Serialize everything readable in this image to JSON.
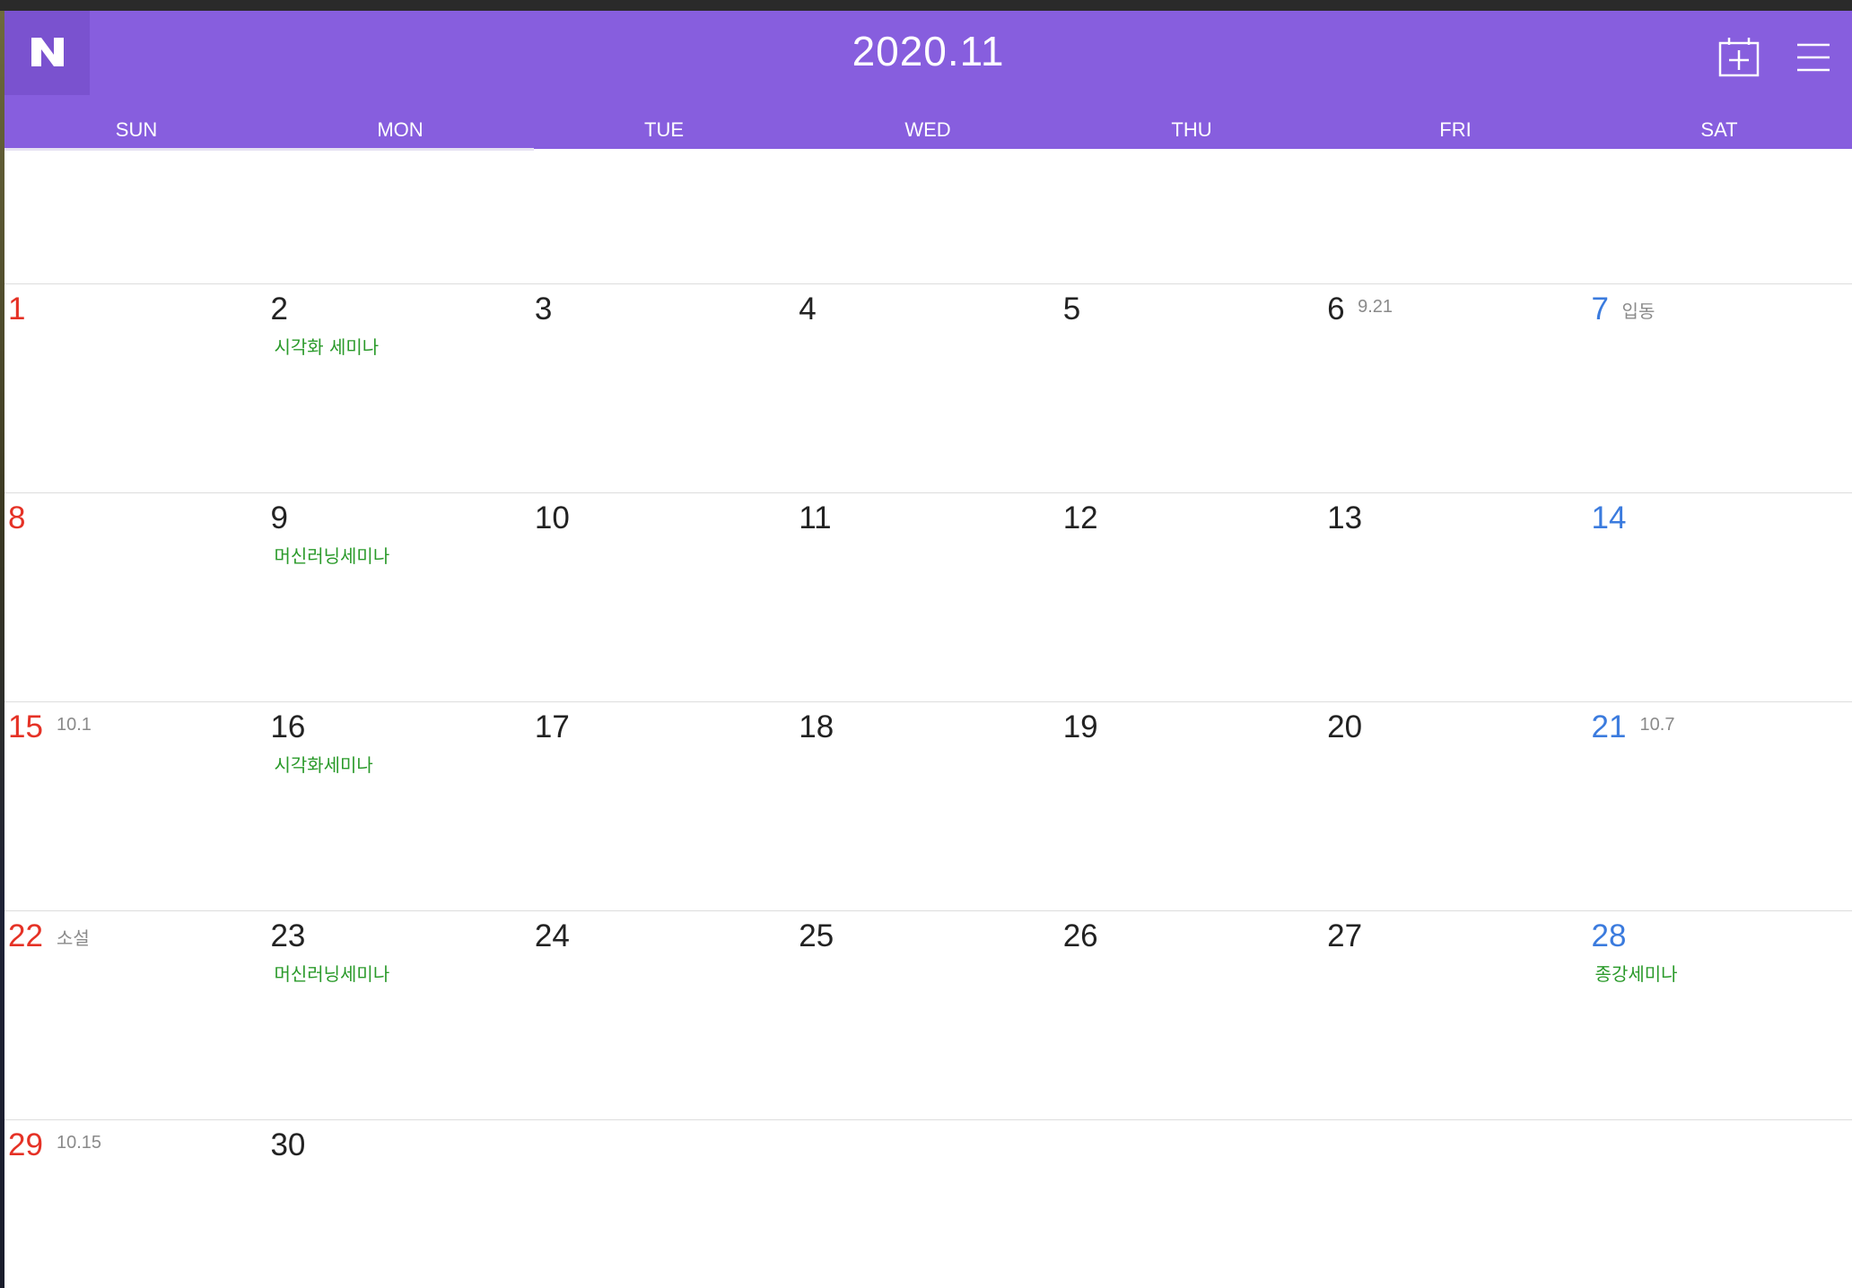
{
  "app": {
    "logo_letter": "N",
    "title": "2020.11"
  },
  "toolbar": {
    "add_icon": "calendar-add-icon",
    "menu_icon": "hamburger-menu-icon"
  },
  "colors": {
    "header": "#875ede",
    "sunday": "#e53125",
    "saturday": "#3b7bde",
    "event": "#2a9a2a",
    "lunar": "#8a8a8a"
  },
  "weekdays": [
    "SUN",
    "MON",
    "TUE",
    "WED",
    "THU",
    "FRI",
    "SAT"
  ],
  "weeks": [
    [
      {
        "day": "",
        "sub": "",
        "event": ""
      },
      {
        "day": "",
        "sub": "",
        "event": ""
      },
      {
        "day": "",
        "sub": "",
        "event": ""
      },
      {
        "day": "",
        "sub": "",
        "event": ""
      },
      {
        "day": "",
        "sub": "",
        "event": ""
      },
      {
        "day": "",
        "sub": "",
        "event": ""
      },
      {
        "day": "",
        "sub": "",
        "event": ""
      }
    ],
    [
      {
        "day": "1",
        "sub": "",
        "event": ""
      },
      {
        "day": "2",
        "sub": "",
        "event": "시각화 세미나"
      },
      {
        "day": "3",
        "sub": "",
        "event": ""
      },
      {
        "day": "4",
        "sub": "",
        "event": ""
      },
      {
        "day": "5",
        "sub": "",
        "event": ""
      },
      {
        "day": "6",
        "sub": "9.21",
        "event": ""
      },
      {
        "day": "7",
        "sub": "입동",
        "event": ""
      }
    ],
    [
      {
        "day": "8",
        "sub": "",
        "event": ""
      },
      {
        "day": "9",
        "sub": "",
        "event": "머신러닝세미나"
      },
      {
        "day": "10",
        "sub": "",
        "event": ""
      },
      {
        "day": "11",
        "sub": "",
        "event": ""
      },
      {
        "day": "12",
        "sub": "",
        "event": ""
      },
      {
        "day": "13",
        "sub": "",
        "event": ""
      },
      {
        "day": "14",
        "sub": "",
        "event": ""
      }
    ],
    [
      {
        "day": "15",
        "sub": "10.1",
        "event": ""
      },
      {
        "day": "16",
        "sub": "",
        "event": "시각화세미나"
      },
      {
        "day": "17",
        "sub": "",
        "event": ""
      },
      {
        "day": "18",
        "sub": "",
        "event": ""
      },
      {
        "day": "19",
        "sub": "",
        "event": ""
      },
      {
        "day": "20",
        "sub": "",
        "event": ""
      },
      {
        "day": "21",
        "sub": "10.7",
        "event": ""
      }
    ],
    [
      {
        "day": "22",
        "sub": "소설",
        "event": ""
      },
      {
        "day": "23",
        "sub": "",
        "event": "머신러닝세미나"
      },
      {
        "day": "24",
        "sub": "",
        "event": ""
      },
      {
        "day": "25",
        "sub": "",
        "event": ""
      },
      {
        "day": "26",
        "sub": "",
        "event": ""
      },
      {
        "day": "27",
        "sub": "",
        "event": ""
      },
      {
        "day": "28",
        "sub": "",
        "event": "종강세미나"
      }
    ],
    [
      {
        "day": "29",
        "sub": "10.15",
        "event": ""
      },
      {
        "day": "30",
        "sub": "",
        "event": ""
      },
      {
        "day": "",
        "sub": "",
        "event": ""
      },
      {
        "day": "",
        "sub": "",
        "event": ""
      },
      {
        "day": "",
        "sub": "",
        "event": ""
      },
      {
        "day": "",
        "sub": "",
        "event": ""
      },
      {
        "day": "",
        "sub": "",
        "event": ""
      }
    ]
  ]
}
